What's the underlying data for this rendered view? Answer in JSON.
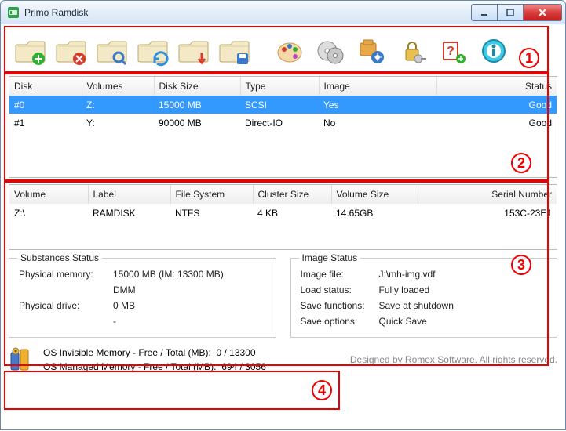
{
  "window": {
    "title": "Primo Ramdisk"
  },
  "toolbar": {
    "items": [
      {
        "name": "new-disk",
        "badge": "plus",
        "badge_color": "#2fae2f"
      },
      {
        "name": "delete-disk",
        "badge": "x",
        "badge_color": "#d43b2b"
      },
      {
        "name": "search-disk",
        "badge": "lens",
        "badge_color": "#3b79c7"
      },
      {
        "name": "refresh-disk",
        "badge": "sync",
        "badge_color": "#2f8fd8"
      },
      {
        "name": "import-disk",
        "badge": "arrowdn",
        "badge_color": "#d43b2b"
      },
      {
        "name": "save-disk",
        "badge": "disk",
        "badge_color": "#3b79c7"
      }
    ]
  },
  "disk_table": {
    "columns": [
      "Disk",
      "Volumes",
      "Disk Size",
      "Type",
      "Image",
      "Status"
    ],
    "rows": [
      {
        "cells": [
          "#0",
          "Z:",
          "15000 MB",
          "SCSI",
          "Yes",
          "Good"
        ],
        "selected": true
      },
      {
        "cells": [
          "#1",
          "Y:",
          "90000 MB",
          "Direct-IO",
          "No",
          "Good"
        ],
        "selected": false
      }
    ]
  },
  "volume_table": {
    "columns": [
      "Volume",
      "Label",
      "File System",
      "Cluster Size",
      "Volume Size",
      "Serial Number"
    ],
    "rows": [
      {
        "cells": [
          "Z:\\",
          "RAMDISK",
          "NTFS",
          "4 KB",
          "14.65GB",
          "153C-23E1"
        ]
      }
    ]
  },
  "substances": {
    "title": "Substances Status",
    "phys_mem_label": "Physical memory:",
    "phys_mem_value": "15000 MB (IM: 13300 MB)",
    "phys_mem_extra": "DMM",
    "phys_drive_label": "Physical drive:",
    "phys_drive_value": "0 MB",
    "phys_drive_extra": "-"
  },
  "image_status": {
    "title": "Image Status",
    "file_label": "Image file:",
    "file_value": "J:\\mh-img.vdf",
    "load_label": "Load status:",
    "load_value": "Fully loaded",
    "save_fn_label": "Save functions:",
    "save_fn_value": "Save at shutdown",
    "save_opt_label": "Save options:",
    "save_opt_value": "Quick Save"
  },
  "footer": {
    "invisible_label": "OS Invisible Memory - Free / Total (MB):",
    "invisible_value": "0 / 13300",
    "managed_label": "OS Managed Memory - Free / Total (MB):",
    "managed_value": "694 / 3056",
    "designed_by": "Designed by Romex Software. All rights reserved."
  },
  "overlays": {
    "n1": "1",
    "n2": "2",
    "n3": "3",
    "n4": "4"
  }
}
